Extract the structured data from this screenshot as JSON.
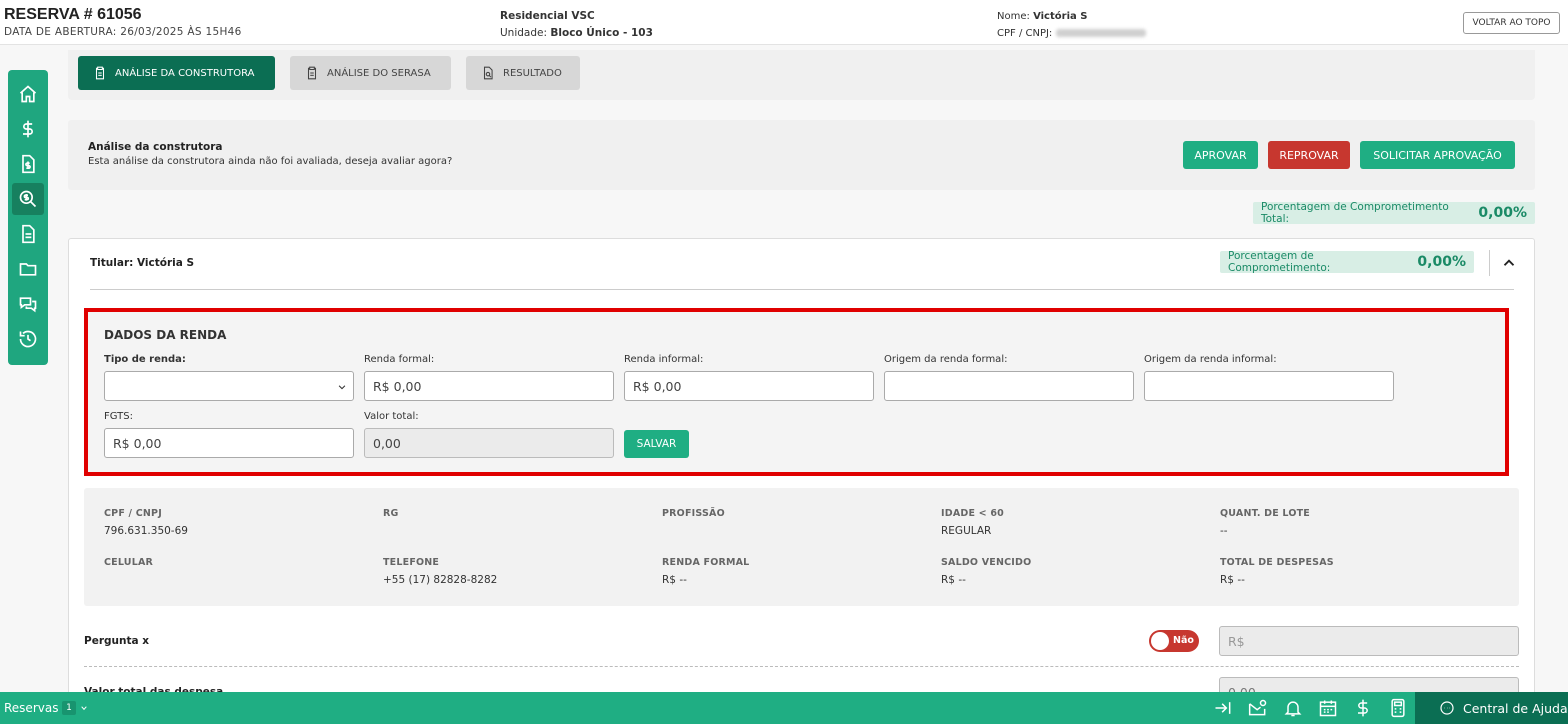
{
  "header": {
    "reserva_title": "RESERVA # 61056",
    "abertura": "DATA DE ABERTURA: 26/03/2025 ÀS 15H46",
    "empreendimento": "Residencial VSC",
    "unidade_label": "Unidade:",
    "unidade_value": "Bloco Único - 103",
    "nome_label": "Nome:",
    "nome_value": "Victória S",
    "cpf_label": "CPF / CNPJ:",
    "back_to_top": "VOLTAR AO TOPO"
  },
  "tabs": [
    {
      "label": "ANÁLISE DA CONSTRUTORA",
      "icon": "clipboard-icon"
    },
    {
      "label": "ANÁLISE DO SERASA",
      "icon": "clipboard-icon"
    },
    {
      "label": "RESULTADO",
      "icon": "document-search-icon"
    }
  ],
  "analysis": {
    "title": "Análise da construtora",
    "description": "Esta análise da construtora ainda não foi avaliada, deseja avaliar agora?",
    "approve": "APROVAR",
    "reject": "REPROVAR",
    "request": "SOLICITAR APROVAÇÃO"
  },
  "total_pct": {
    "label": "Porcentagem de Comprometimento Total:",
    "value": "0,00%"
  },
  "titular": {
    "label": "Titular: Victória S",
    "pct_label": "Porcentagem de Comprometimento:",
    "pct_value": "0,00%"
  },
  "renda": {
    "title": "DADOS DA RENDA",
    "tipo_label": "Tipo de renda:",
    "formal_label": "Renda formal:",
    "formal_value": "R$ 0,00",
    "informal_label": "Renda informal:",
    "informal_value": "R$ 0,00",
    "origem_formal_label": "Origem da renda formal:",
    "origem_informal_label": "Origem da renda informal:",
    "fgts_label": "FGTS:",
    "fgts_value": "R$ 0,00",
    "total_label": "Valor total:",
    "total_value": "0,00",
    "save": "SALVAR"
  },
  "info": {
    "cpf_label": "CPF / CNPJ",
    "cpf_value": "796.631.350-69",
    "rg_label": "RG",
    "profissao_label": "PROFISSÃO",
    "idade_label": "IDADE < 60",
    "idade_value": "REGULAR",
    "lote_label": "QUANT. DE LOTE",
    "lote_value": "--",
    "celular_label": "CELULAR",
    "telefone_label": "TELEFONE",
    "telefone_value": "+55 (17) 82828-8282",
    "renda_formal_label": "RENDA FORMAL",
    "renda_formal_value": "R$ --",
    "saldo_label": "SALDO VENCIDO",
    "saldo_value": "R$ --",
    "despesas_label": "TOTAL DE DESPESAS",
    "despesas_value": "R$ --"
  },
  "pergunta": {
    "label": "Pergunta x",
    "toggle": "Não",
    "placeholder": "R$",
    "next_label": "Valor total das despesa",
    "next_value": "0,00"
  },
  "bottombar": {
    "reservas": "Reservas",
    "count": "1",
    "help": "Central de Ajuda"
  },
  "colors": {
    "primary": "#1fae83",
    "dark": "#0b6e53",
    "danger": "#c7372f",
    "highlight": "#e00000"
  }
}
